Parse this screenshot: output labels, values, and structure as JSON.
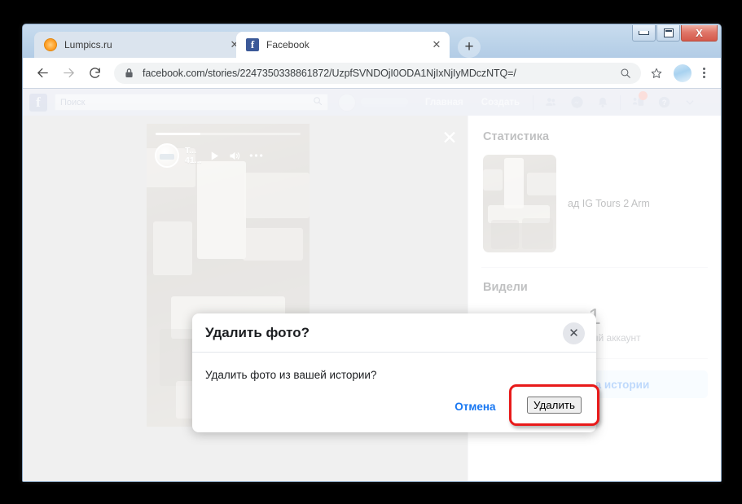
{
  "window": {
    "controls": {
      "minimize": "minimize-button",
      "maximize": "maximize-button",
      "close_label": "X"
    }
  },
  "tabs": [
    {
      "title": "Lumpics.ru",
      "favicon": "orange-circle-icon",
      "active": false,
      "close_label": "✕"
    },
    {
      "title": "Facebook",
      "favicon": "facebook-f-icon",
      "favicon_letter": "f",
      "active": true,
      "close_label": "✕"
    }
  ],
  "new_tab_label": "+",
  "toolbar": {
    "back_label": "←",
    "forward_label": "→",
    "reload_label": "↻",
    "url": "facebook.com/stories/2247350338861872/UzpfSVNDOjI0ODA1NjIxNjIyMDczNTQ=/",
    "lock_icon": "padlock-icon",
    "zoom_search_icon": "search-icon",
    "bookmark_icon": "star-icon",
    "profile_icon": "avatar-icon",
    "menu_icon": "kebab-menu-icon"
  },
  "facebook_bar": {
    "logo_letter": "f",
    "search_placeholder": "Поиск",
    "search_icon": "search-icon",
    "links": [
      "Главная",
      "Создать"
    ],
    "icons": [
      "friend-requests-icon",
      "messenger-icon",
      "notifications-icon",
      "help-group-icon",
      "help-icon",
      "chevron-down-icon"
    ]
  },
  "story": {
    "progress_percent": 31,
    "author_line1": "T...",
    "author_line2": "41...",
    "play_icon": "play-icon",
    "volume_icon": "volume-icon",
    "more_icon": "ellipsis-icon",
    "close_icon": "close-icon"
  },
  "stats_panel": {
    "title": "Статистика",
    "thumbnail_name": "story-thumbnail",
    "caption": "ад IG Tours 2 Arm",
    "seen_title": "Видели",
    "seen_count": "1",
    "seen_label": "Уникальный аккаунт",
    "cta_label": "Статистика истории"
  },
  "dialog": {
    "title": "Удалить фото?",
    "body": "Удалить фото из вашей истории?",
    "cancel_label": "Отмена",
    "confirm_label": "Удалить",
    "close_label": "✕"
  },
  "colors": {
    "accent_blue": "#1877f2",
    "annotation_red": "#e81a1a",
    "fb_bar": "#dfe3ee",
    "cta_bg": "#e7f3ff"
  }
}
